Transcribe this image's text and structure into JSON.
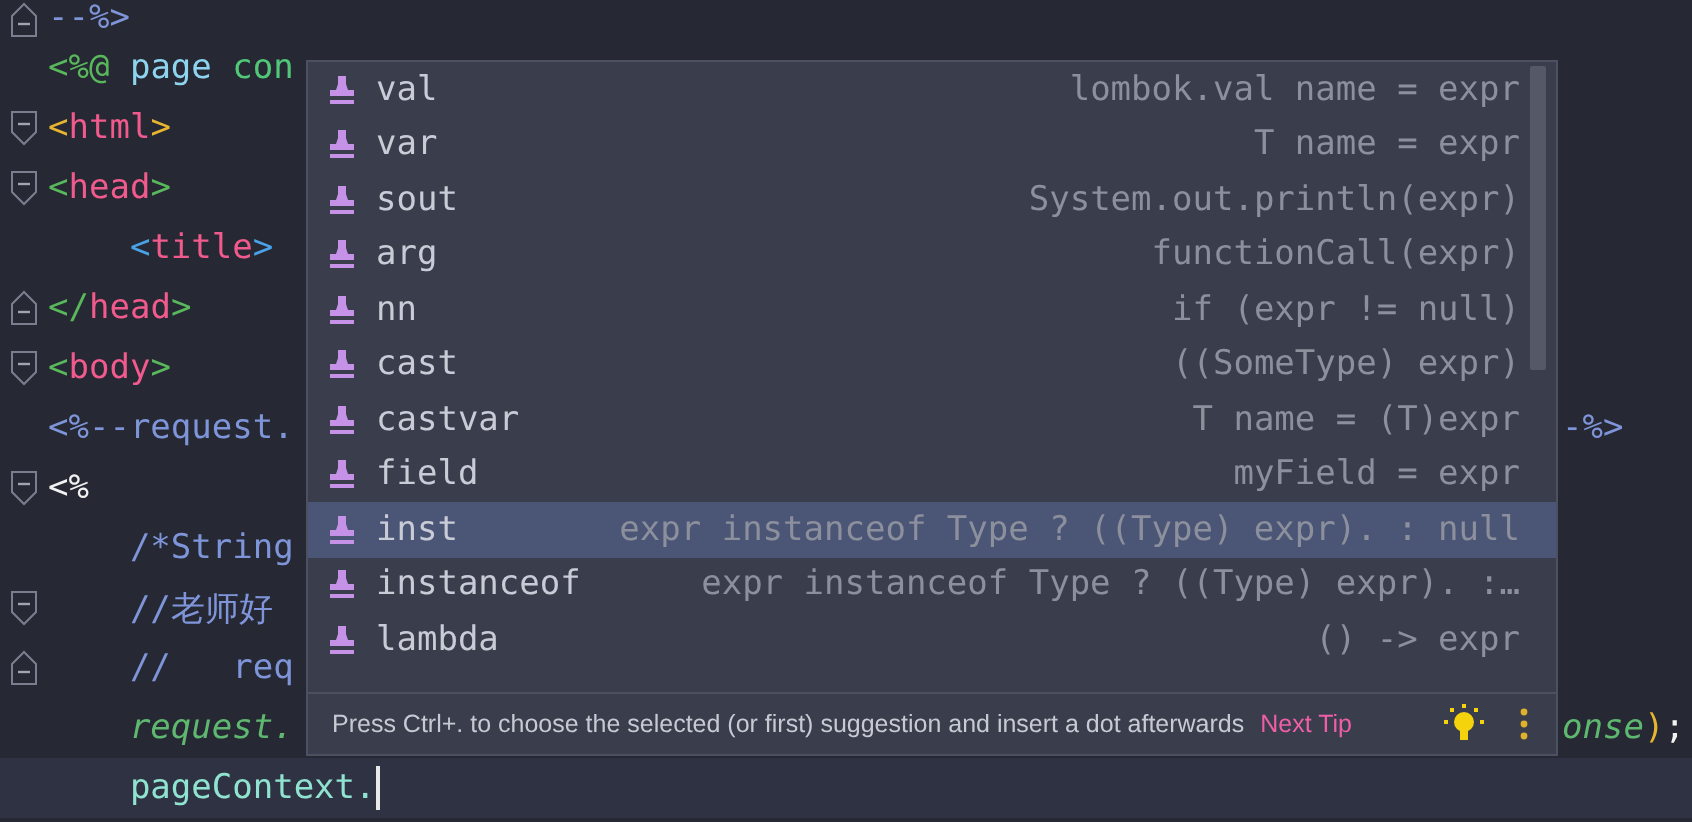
{
  "editor": {
    "lines": [
      {
        "fold_start": false,
        "fold_end": true,
        "tokens": [
          {
            "text": "--%>",
            "kind": "comment"
          }
        ]
      },
      {
        "fold_start": false,
        "fold_end": false,
        "tokens": [
          {
            "text": "<%@ ",
            "kind": "directive"
          },
          {
            "text": "page ",
            "kind": "keyword"
          },
          {
            "text": "con",
            "kind": "attribute"
          }
        ]
      },
      {
        "fold_start": true,
        "fold_end": false,
        "tokens": [
          {
            "text": "<",
            "kind": "brace-outer"
          },
          {
            "text": "html",
            "kind": "tag"
          },
          {
            "text": ">",
            "kind": "brace-outer"
          }
        ]
      },
      {
        "fold_start": true,
        "fold_end": false,
        "tokens": [
          {
            "text": "<",
            "kind": "brace-middle"
          },
          {
            "text": "head",
            "kind": "tag"
          },
          {
            "text": ">",
            "kind": "brace-middle"
          }
        ]
      },
      {
        "fold_start": false,
        "fold_end": false,
        "tokens": [
          {
            "text": "    <",
            "kind": "brace-inner"
          },
          {
            "text": "title",
            "kind": "tag"
          },
          {
            "text": ">",
            "kind": "brace-inner"
          }
        ]
      },
      {
        "fold_start": false,
        "fold_end": true,
        "tokens": [
          {
            "text": "</",
            "kind": "brace-middle"
          },
          {
            "text": "head",
            "kind": "tag"
          },
          {
            "text": ">",
            "kind": "brace-middle"
          }
        ]
      },
      {
        "fold_start": true,
        "fold_end": false,
        "tokens": [
          {
            "text": "<",
            "kind": "brace-middle"
          },
          {
            "text": "body",
            "kind": "tag"
          },
          {
            "text": ">",
            "kind": "brace-middle"
          }
        ]
      },
      {
        "fold_start": false,
        "fold_end": false,
        "tokens": [
          {
            "text": "<%--request.",
            "kind": "comment"
          }
        ],
        "right_tokens": [
          {
            "text": "-%>",
            "kind": "comment"
          }
        ]
      },
      {
        "fold_start": true,
        "fold_end": false,
        "tokens": [
          {
            "text": "<%",
            "kind": "plain"
          }
        ]
      },
      {
        "fold_start": false,
        "fold_end": false,
        "tokens": [
          {
            "text": "    /*String",
            "kind": "comment"
          }
        ]
      },
      {
        "fold_start": true,
        "fold_end": false,
        "tokens": [
          {
            "text": "    //老师好",
            "kind": "comment"
          }
        ]
      },
      {
        "fold_start": false,
        "fold_end": true,
        "tokens": [
          {
            "text": "    //   req",
            "kind": "comment"
          }
        ]
      },
      {
        "fold_start": false,
        "fold_end": false,
        "tokens": [
          {
            "text": "    request.",
            "kind": "implicit"
          }
        ],
        "right_tokens": [
          {
            "text": "onse",
            "kind": "implicit"
          },
          {
            "text": ")",
            "kind": "brace-outer"
          },
          {
            "text": ";",
            "kind": "plain"
          }
        ]
      },
      {
        "fold_start": false,
        "fold_end": false,
        "current": true,
        "cursor": true,
        "tokens": [
          {
            "text": "    pageContext.",
            "kind": "variable"
          }
        ]
      }
    ]
  },
  "completion": {
    "items": [
      {
        "name": "val",
        "hint": "lombok.val name = expr",
        "selected": false
      },
      {
        "name": "var",
        "hint": "T name = expr",
        "selected": false
      },
      {
        "name": "sout",
        "hint": "System.out.println(expr)",
        "selected": false
      },
      {
        "name": "arg",
        "hint": "functionCall(expr)",
        "selected": false
      },
      {
        "name": "nn",
        "hint": "if (expr != null)",
        "selected": false
      },
      {
        "name": "cast",
        "hint": "((SomeType) expr)",
        "selected": false
      },
      {
        "name": "castvar",
        "hint": "T name = (T)expr",
        "selected": false
      },
      {
        "name": "field",
        "hint": "myField = expr",
        "selected": false
      },
      {
        "name": "inst",
        "hint": "expr instanceof Type ? ((Type) expr). : null",
        "selected": true
      },
      {
        "name": "instanceof",
        "hint": "expr instanceof Type ? ((Type) expr). :…",
        "selected": false
      },
      {
        "name": "lambda",
        "hint": "() -> expr",
        "selected": false
      }
    ],
    "tip": {
      "text": "Press Ctrl+. to choose the selected (or first) suggestion and insert a dot afterwards",
      "link": "Next Tip"
    }
  }
}
